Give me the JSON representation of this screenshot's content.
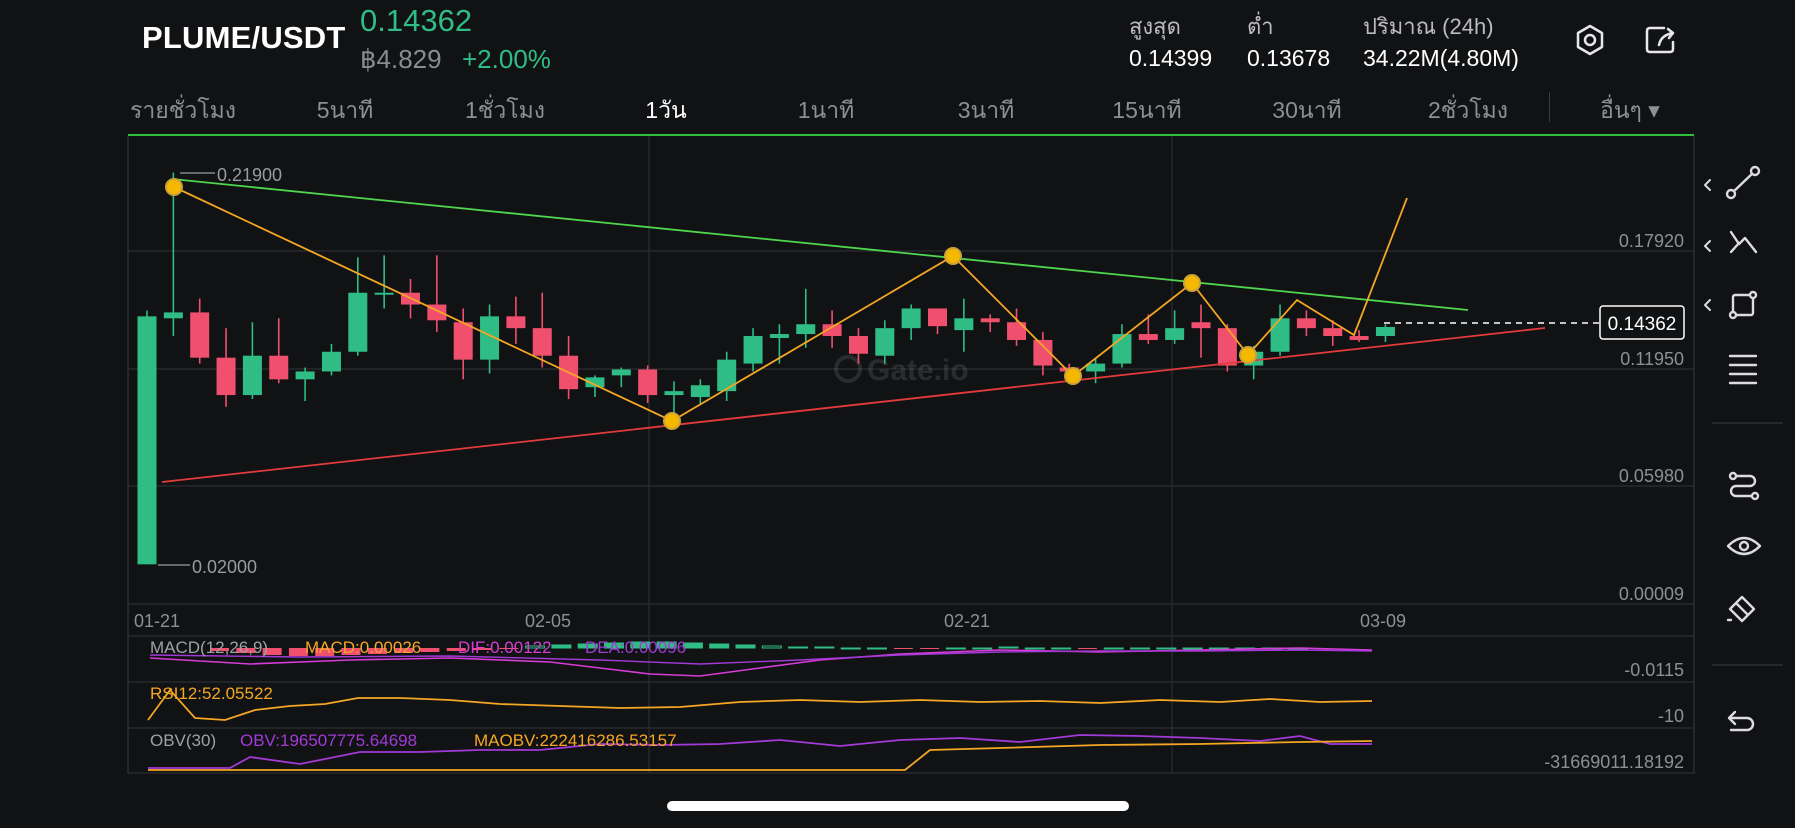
{
  "header": {
    "pair": "PLUME/USDT",
    "last_price": "0.14362",
    "local_price": "฿4.829",
    "change_pct": "+2.00%",
    "stats": [
      {
        "label": "สูงสุด",
        "value": "0.14399"
      },
      {
        "label": "ต่ำ",
        "value": "0.13678"
      },
      {
        "label": "ปริมาณ (24h)",
        "value": "34.22M(4.80M)"
      }
    ],
    "icons": [
      "settings-icon",
      "share-icon"
    ]
  },
  "timeframe_tabs": [
    {
      "label": "รายชั่วโมง",
      "active": false
    },
    {
      "label": "5นาที",
      "active": false
    },
    {
      "label": "1ชั่วโมง",
      "active": false
    },
    {
      "label": "1วัน",
      "active": true
    },
    {
      "label": "1นาที",
      "active": false
    },
    {
      "label": "3นาที",
      "active": false
    },
    {
      "label": "15นาที",
      "active": false
    },
    {
      "label": "30นาที",
      "active": false
    },
    {
      "label": "2ชั่วโมง",
      "active": false
    }
  ],
  "more_tab": "อื่นๆ ▾",
  "chart": {
    "watermark": "Gate.io",
    "current_price_label": "0.14362",
    "high_marker": "0.21900",
    "low_marker": "0.02000",
    "y_axis_labels": [
      "0.17920",
      "0.11950",
      "0.05980",
      "0.00009"
    ],
    "x_axis_labels": [
      "01-21",
      "02-05",
      "02-21",
      "03-09"
    ]
  },
  "indicators": {
    "macd": {
      "name": "MACD(12,26,9)",
      "macd": "MACD:0.00026",
      "dif": "DIF:0.00122",
      "dea": "DEA:0.00096",
      "axis_label": "-0.0115"
    },
    "rsi": {
      "value": "RSI12:52.05522",
      "axis_label": "-10"
    },
    "obv": {
      "name": "OBV(30)",
      "obv": "OBV:196507775.64698",
      "maobv": "MAOBV:222416286.53157",
      "axis_label": "-31669011.18192"
    }
  },
  "toolbar_icons": [
    "trend-line-icon",
    "zigzag-pattern-icon",
    "rectangle-icon",
    "fib-lines-icon",
    "path-icon",
    "eye-icon",
    "eraser-icon",
    "undo-icon"
  ],
  "colors": {
    "up": "#2fbd85",
    "down": "#f0506e",
    "accent_orange": "#f5a623",
    "trend_green": "#4fd64f",
    "trend_red": "#e33b3b",
    "macd_purple": "#a23ad7",
    "obv_pink": "#d63cd6"
  },
  "chart_data": {
    "type": "candlestick",
    "title": "PLUME/USDT 1D",
    "x_labels": [
      "01-21",
      "02-05",
      "02-21",
      "03-09"
    ],
    "ylim": [
      9e-05,
      0.23
    ],
    "candles": [
      {
        "o": 0.02,
        "h": 0.149,
        "l": 0.02,
        "c": 0.146
      },
      {
        "o": 0.145,
        "h": 0.219,
        "l": 0.136,
        "c": 0.148
      },
      {
        "o": 0.148,
        "h": 0.155,
        "l": 0.122,
        "c": 0.125
      },
      {
        "o": 0.125,
        "h": 0.14,
        "l": 0.1,
        "c": 0.106
      },
      {
        "o": 0.106,
        "h": 0.143,
        "l": 0.104,
        "c": 0.126
      },
      {
        "o": 0.126,
        "h": 0.145,
        "l": 0.112,
        "c": 0.114
      },
      {
        "o": 0.114,
        "h": 0.12,
        "l": 0.103,
        "c": 0.118
      },
      {
        "o": 0.118,
        "h": 0.132,
        "l": 0.116,
        "c": 0.128
      },
      {
        "o": 0.128,
        "h": 0.176,
        "l": 0.126,
        "c": 0.158
      },
      {
        "o": 0.158,
        "h": 0.177,
        "l": 0.15,
        "c": 0.158
      },
      {
        "o": 0.158,
        "h": 0.165,
        "l": 0.145,
        "c": 0.152
      },
      {
        "o": 0.152,
        "h": 0.177,
        "l": 0.138,
        "c": 0.144
      },
      {
        "o": 0.143,
        "h": 0.15,
        "l": 0.114,
        "c": 0.124
      },
      {
        "o": 0.124,
        "h": 0.152,
        "l": 0.117,
        "c": 0.146
      },
      {
        "o": 0.146,
        "h": 0.156,
        "l": 0.132,
        "c": 0.14
      },
      {
        "o": 0.14,
        "h": 0.158,
        "l": 0.12,
        "c": 0.126
      },
      {
        "o": 0.126,
        "h": 0.136,
        "l": 0.104,
        "c": 0.109
      },
      {
        "o": 0.11,
        "h": 0.116,
        "l": 0.105,
        "c": 0.115
      },
      {
        "o": 0.116,
        "h": 0.12,
        "l": 0.11,
        "c": 0.119
      },
      {
        "o": 0.119,
        "h": 0.121,
        "l": 0.102,
        "c": 0.106
      },
      {
        "o": 0.106,
        "h": 0.113,
        "l": 0.094,
        "c": 0.108
      },
      {
        "o": 0.105,
        "h": 0.114,
        "l": 0.101,
        "c": 0.111
      },
      {
        "o": 0.108,
        "h": 0.128,
        "l": 0.103,
        "c": 0.124
      },
      {
        "o": 0.122,
        "h": 0.14,
        "l": 0.118,
        "c": 0.136
      },
      {
        "o": 0.135,
        "h": 0.142,
        "l": 0.122,
        "c": 0.137
      },
      {
        "o": 0.137,
        "h": 0.16,
        "l": 0.13,
        "c": 0.142
      },
      {
        "o": 0.142,
        "h": 0.149,
        "l": 0.13,
        "c": 0.136
      },
      {
        "o": 0.136,
        "h": 0.14,
        "l": 0.122,
        "c": 0.127
      },
      {
        "o": 0.126,
        "h": 0.144,
        "l": 0.122,
        "c": 0.14
      },
      {
        "o": 0.14,
        "h": 0.152,
        "l": 0.134,
        "c": 0.15
      },
      {
        "o": 0.15,
        "h": 0.15,
        "l": 0.137,
        "c": 0.141
      },
      {
        "o": 0.139,
        "h": 0.155,
        "l": 0.128,
        "c": 0.145
      },
      {
        "o": 0.145,
        "h": 0.147,
        "l": 0.138,
        "c": 0.143
      },
      {
        "o": 0.143,
        "h": 0.15,
        "l": 0.131,
        "c": 0.134
      },
      {
        "o": 0.134,
        "h": 0.138,
        "l": 0.116,
        "c": 0.121
      },
      {
        "o": 0.12,
        "h": 0.122,
        "l": 0.114,
        "c": 0.118
      },
      {
        "o": 0.118,
        "h": 0.125,
        "l": 0.112,
        "c": 0.122
      },
      {
        "o": 0.122,
        "h": 0.142,
        "l": 0.12,
        "c": 0.137
      },
      {
        "o": 0.137,
        "h": 0.147,
        "l": 0.132,
        "c": 0.134
      },
      {
        "o": 0.134,
        "h": 0.149,
        "l": 0.132,
        "c": 0.14
      },
      {
        "o": 0.143,
        "h": 0.152,
        "l": 0.125,
        "c": 0.14
      },
      {
        "o": 0.14,
        "h": 0.142,
        "l": 0.118,
        "c": 0.121
      },
      {
        "o": 0.121,
        "h": 0.131,
        "l": 0.114,
        "c": 0.128
      },
      {
        "o": 0.128,
        "h": 0.152,
        "l": 0.126,
        "c": 0.145
      },
      {
        "o": 0.145,
        "h": 0.149,
        "l": 0.136,
        "c": 0.14
      },
      {
        "o": 0.14,
        "h": 0.144,
        "l": 0.131,
        "c": 0.136
      },
      {
        "o": 0.136,
        "h": 0.139,
        "l": 0.133,
        "c": 0.134
      },
      {
        "o": 0.136,
        "h": 0.142,
        "l": 0.133,
        "c": 0.1406
      }
    ]
  }
}
